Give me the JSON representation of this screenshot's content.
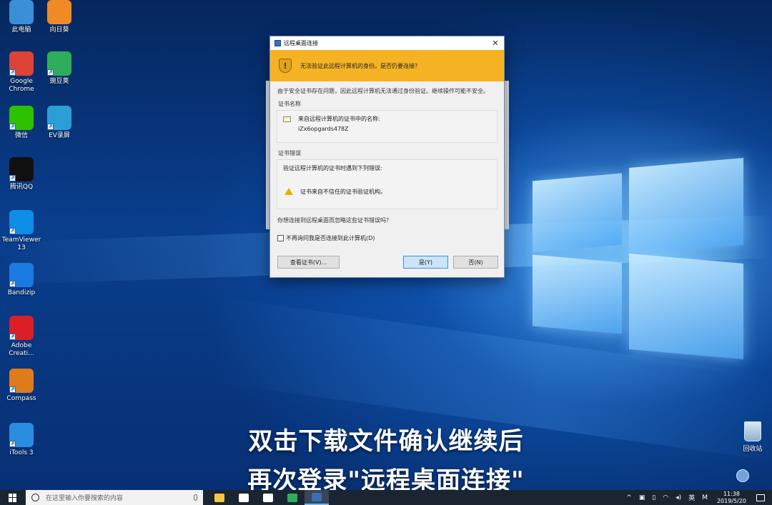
{
  "desktop_icons": [
    {
      "label": "此电脑",
      "icon": "computer-icon",
      "color": "#3a8fd8"
    },
    {
      "label": "向日葵",
      "icon": "sunflower-icon",
      "color": "#f08a24"
    },
    {
      "label": "Google Chrome",
      "icon": "chrome-icon",
      "color": "#db4437"
    },
    {
      "label": "豌豆荚",
      "icon": "wandoujia-icon",
      "color": "#2eae5b"
    },
    {
      "label": "微信",
      "icon": "wechat-icon",
      "color": "#2dc100"
    },
    {
      "label": "EV录屏",
      "icon": "ev-recorder-icon",
      "color": "#2a9fd6"
    },
    {
      "label": "腾讯QQ",
      "icon": "qq-icon",
      "color": "#111111"
    },
    {
      "label": "TeamViewer 13",
      "icon": "teamviewer-icon",
      "color": "#0e8ee9"
    },
    {
      "label": "Bandizip",
      "icon": "bandizip-icon",
      "color": "#1a7ae0"
    },
    {
      "label": "Adobe Creati...",
      "icon": "adobe-cc-icon",
      "color": "#da1f26"
    },
    {
      "label": "Compass",
      "icon": "compass-icon",
      "color": "#e07b1a"
    },
    {
      "label": "iTools 3",
      "icon": "itools-icon",
      "color": "#2b8de0"
    }
  ],
  "recycle_bin": {
    "label": "回收站"
  },
  "dialog": {
    "title": "远程桌面连接",
    "close": "✕",
    "warning_text": "无法验证此远程计算机的身份。是否仍要连接?",
    "description": "由于安全证书存在问题，因此远程计算机无法通过身份验证。继续操作可能不安全。",
    "cert_name_label": "证书名称",
    "cert_name_intro": "来自远程计算机的证书中的名称:",
    "cert_name_value": "iZx6opgards478Z",
    "cert_error_label": "证书错误",
    "cert_error_intro": "验证远程计算机的证书时遇到下列错误:",
    "cert_error_item": "证书来自不信任的证书验证机构。",
    "question": "你想连接到远程桌面而忽略这些证书错误吗?",
    "checkbox_label": "不再询问我是否连接到此计算机(D)",
    "btn_view_cert": "查看证书(V)...",
    "btn_yes": "是(Y)",
    "btn_no": "否(N)"
  },
  "caption": {
    "line1": "双击下载文件确认继续后",
    "line2": "再次登录\"远程桌面连接\""
  },
  "taskbar": {
    "search_placeholder": "在这里输入你要搜索的内容",
    "apps": [
      {
        "name": "file-explorer-icon",
        "color": "#f2c744"
      },
      {
        "name": "store-icon",
        "color": "#ffffff"
      },
      {
        "name": "mail-icon",
        "color": "#ffffff"
      },
      {
        "name": "wandoujia-icon",
        "color": "#2eae5b"
      },
      {
        "name": "remote-desktop-icon",
        "color": "#3a6fb5"
      }
    ],
    "tray_ime": "英",
    "tray_m": "M",
    "time": "11:38",
    "date": "2019/5/20"
  }
}
